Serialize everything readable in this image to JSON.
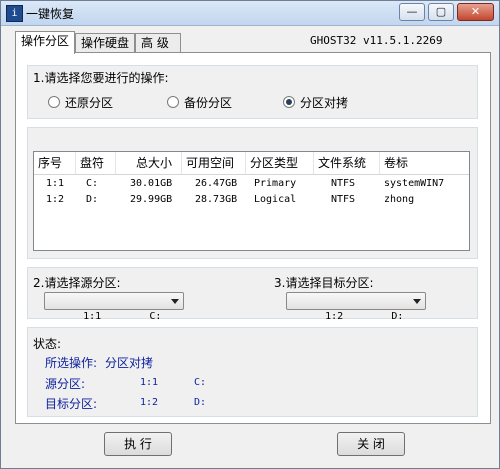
{
  "window": {
    "title": "一键恢复",
    "app_icon": "ghost-app-icon"
  },
  "tabs": [
    {
      "label": "操作分区",
      "active": true
    },
    {
      "label": "操作硬盘",
      "active": false
    },
    {
      "label": "高 级",
      "active": false
    }
  ],
  "version": "GHOST32 v11.5.1.2269",
  "operation": {
    "heading": "1.请选择您要进行的操作:",
    "options": [
      {
        "label": "还原分区",
        "selected": false
      },
      {
        "label": "备份分区",
        "selected": false
      },
      {
        "label": "分区对拷",
        "selected": true
      }
    ]
  },
  "table": {
    "headers": [
      "序号",
      "盘符",
      "总大小",
      "可用空间",
      "分区类型",
      "文件系统",
      "卷标"
    ],
    "rows": [
      [
        "1:1",
        "C:",
        "30.01GB",
        "26.47GB",
        "Primary",
        "NTFS",
        "systemWIN7"
      ],
      [
        "1:2",
        "D:",
        "29.99GB",
        "28.73GB",
        "Logical",
        "NTFS",
        "zhong"
      ]
    ]
  },
  "source": {
    "label": "2.请选择源分区:",
    "value": "1:1        C:"
  },
  "target": {
    "label": "3.请选择目标分区:",
    "value": "1:2        D:"
  },
  "status": {
    "title": "状态:",
    "operation_label": "所选操作:",
    "operation_value": "分区对拷",
    "source_label": "源分区:",
    "source_id": "1:1",
    "source_drive": "C:",
    "target_label": "目标分区:",
    "target_id": "1:2",
    "target_drive": "D:"
  },
  "buttons": {
    "execute": "执 行",
    "close": "关 闭"
  },
  "caption_buttons": {
    "minimize": "—",
    "maximize": "▢",
    "close": "✕"
  }
}
